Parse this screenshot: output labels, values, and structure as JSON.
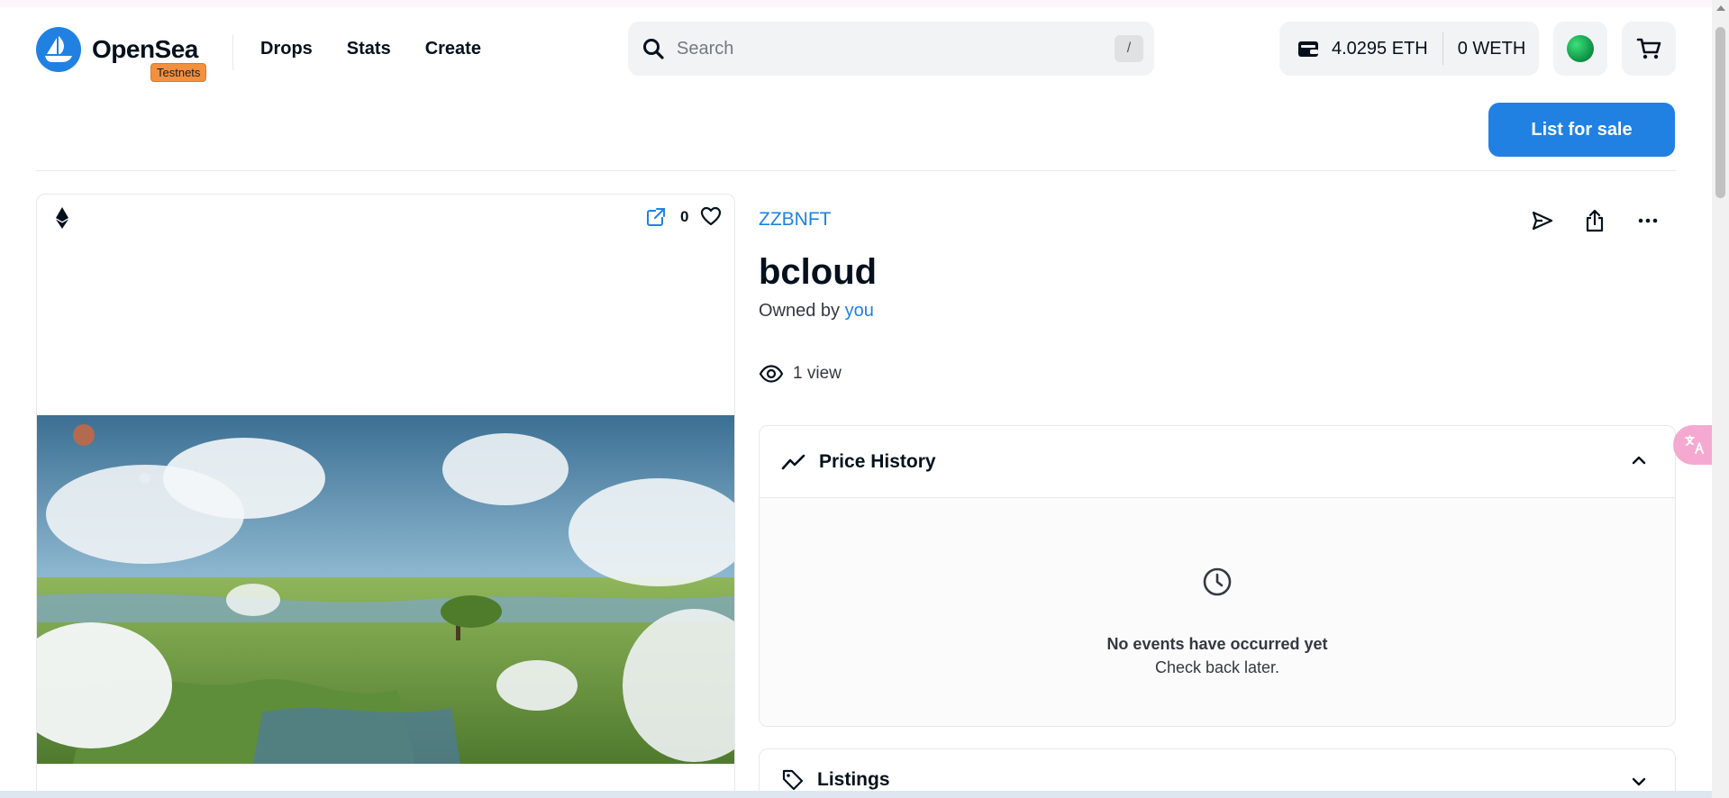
{
  "header": {
    "brand": "OpenSea",
    "badge": "Testnets",
    "nav": [
      "Drops",
      "Stats",
      "Create"
    ],
    "search_placeholder": "Search",
    "search_shortcut": "/",
    "wallet": {
      "eth": "4.0295 ETH",
      "weth": "0 WETH"
    }
  },
  "toolbar": {
    "list_for_sale": "List for sale"
  },
  "item": {
    "collection": "ZZBNFT",
    "title": "bcloud",
    "owned_prefix": "Owned by",
    "owner": "you",
    "views": "1 view",
    "favorites": "0"
  },
  "price_history": {
    "title": "Price History",
    "empty_title": "No events have occurred yet",
    "empty_sub": "Check back later."
  },
  "listings": {
    "title": "Listings"
  },
  "colors": {
    "accent": "#2081e2",
    "badge": "#f3903f"
  },
  "icons": [
    "search-icon",
    "wallet-icon",
    "cart-icon",
    "ethereum-icon",
    "external-link-icon",
    "heart-icon",
    "send-icon",
    "share-icon",
    "more-icon",
    "eye-icon",
    "trend-icon",
    "chevron-up-icon",
    "clock-icon",
    "tag-icon",
    "chevron-down-icon",
    "translate-icon"
  ]
}
